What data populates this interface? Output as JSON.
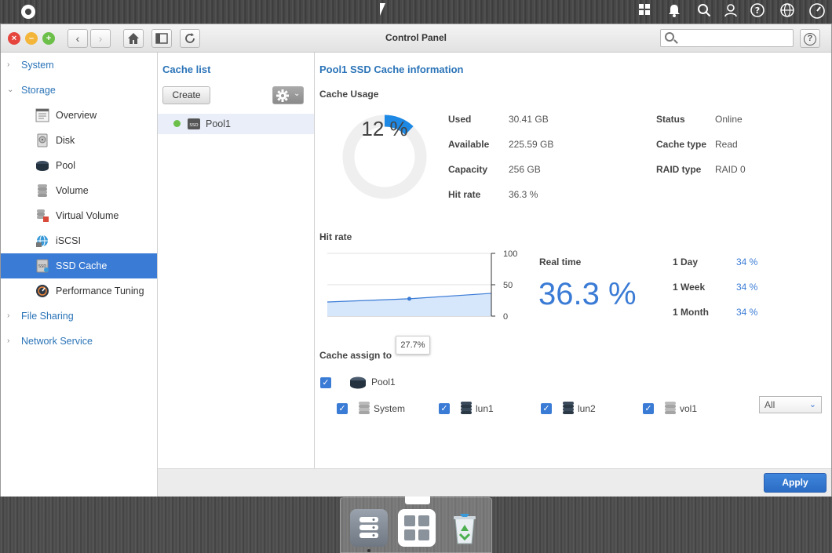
{
  "window": {
    "title": "Control Panel",
    "search_placeholder": ""
  },
  "colors": {
    "accent": "#3a7bd5",
    "donut_used": "#1e88e5",
    "donut_track": "#efefef",
    "status_online": "#6cc04a"
  },
  "icons": {
    "tray": [
      "grid-icon",
      "bell-icon",
      "search-icon",
      "user-icon",
      "help-icon",
      "globe-icon",
      "dashboard-icon"
    ],
    "dock": [
      "server-app-icon",
      "apps-grid-icon",
      "recycle-bin-icon"
    ]
  },
  "sidebar": {
    "groups": [
      {
        "label": "System"
      },
      {
        "label": "Storage"
      },
      {
        "label": "File Sharing"
      },
      {
        "label": "Network Service"
      }
    ],
    "items": [
      {
        "label": "Overview",
        "icon": "overview-icon"
      },
      {
        "label": "Disk",
        "icon": "disk-icon"
      },
      {
        "label": "Pool",
        "icon": "pool-icon"
      },
      {
        "label": "Volume",
        "icon": "volume-icon"
      },
      {
        "label": "Virtual Volume",
        "icon": "virtual-volume-icon"
      },
      {
        "label": "iSCSI",
        "icon": "iscsi-icon"
      },
      {
        "label": "SSD Cache",
        "icon": "ssd-cache-icon",
        "active": true
      },
      {
        "label": "Performance Tuning",
        "icon": "performance-icon"
      }
    ]
  },
  "cache_list": {
    "title": "Cache list",
    "create_label": "Create",
    "items": [
      {
        "name": "Pool1",
        "status_color": "#6cc04a"
      }
    ]
  },
  "info": {
    "title": "Pool1 SSD Cache information",
    "usage_title": "Cache Usage",
    "usage_percent_text": "12 %",
    "usage_fraction": 0.12,
    "left": [
      {
        "label": "Used",
        "value": "30.41 GB"
      },
      {
        "label": "Available",
        "value": "225.59 GB"
      },
      {
        "label": "Capacity",
        "value": "256 GB"
      },
      {
        "label": "Hit rate",
        "value": "36.3 %"
      }
    ],
    "right": [
      {
        "label": "Status",
        "value": "Online"
      },
      {
        "label": "Cache type",
        "value": "Read"
      },
      {
        "label": "RAID type",
        "value": "RAID 0"
      }
    ]
  },
  "hitrate": {
    "title": "Hit rate",
    "y_ticks": [
      "100",
      "50",
      "0"
    ],
    "tooltip": "27.7%",
    "realtime_label": "Real time",
    "realtime_value": "36.3 %",
    "periods": [
      {
        "label": "1 Day",
        "value": "34 %"
      },
      {
        "label": "1 Week",
        "value": "34 %"
      },
      {
        "label": "1 Month",
        "value": "34 %"
      }
    ]
  },
  "chart_data": {
    "type": "area",
    "x": [
      0,
      1,
      2
    ],
    "series": [
      {
        "values": [
          22.5,
          27.7,
          36.3
        ]
      }
    ],
    "ylim": [
      0,
      100
    ],
    "yticks": [
      0,
      50,
      100
    ],
    "grid": true
  },
  "assign": {
    "title": "Cache assign to",
    "pool": "Pool1",
    "filter_value": "All",
    "volumes": [
      "System",
      "lun1",
      "lun2",
      "vol1"
    ]
  },
  "footer": {
    "apply_label": "Apply"
  }
}
